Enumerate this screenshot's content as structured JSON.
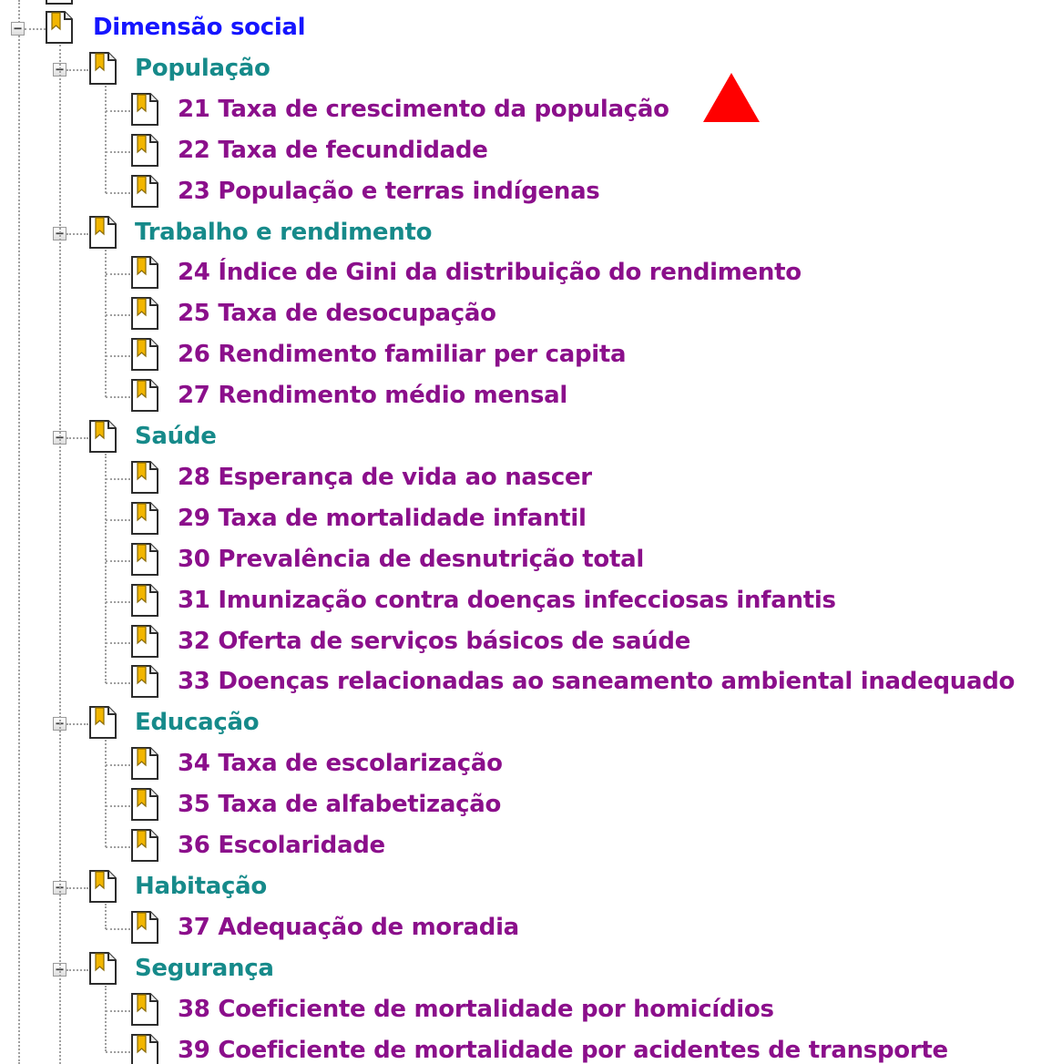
{
  "tree": {
    "root": {
      "label": "Dimensão social",
      "icon": "bookmark-icon",
      "expanded": true,
      "sections": [
        {
          "label": "População",
          "items": [
            "21 Taxa de crescimento da população",
            "22 Taxa de fecundidade",
            "23 População e terras indígenas"
          ]
        },
        {
          "label": "Trabalho e rendimento",
          "items": [
            "24 Índice de Gini da distribuição do rendimento",
            "25 Taxa de desocupação",
            "26 Rendimento familiar per capita",
            "27 Rendimento médio mensal"
          ]
        },
        {
          "label": "Saúde",
          "items": [
            "28 Esperança de vida ao nascer",
            "29 Taxa de mortalidade infantil",
            "30 Prevalência de desnutrição total",
            "31 Imunização contra doenças infecciosas infantis",
            "32 Oferta de serviços básicos de saúde",
            "33 Doenças relacionadas ao saneamento ambiental inadequado"
          ]
        },
        {
          "label": "Educação",
          "items": [
            "34 Taxa de escolarização",
            "35 Taxa de alfabetização",
            "36 Escolaridade"
          ]
        },
        {
          "label": "Habitação",
          "items": [
            "37 Adequação de moradia"
          ]
        },
        {
          "label": "Segurança",
          "items": [
            "38 Coeficiente de mortalidade por homicídios",
            "39 Coeficiente de mortalidade por acidentes de transporte"
          ]
        }
      ]
    }
  },
  "marker": {
    "shape": "triangle-up",
    "color": "#ff0000"
  },
  "colors": {
    "root": "#1515ff",
    "section": "#168a8a",
    "item": "#8b0f8b",
    "connector": "#a0a0a0"
  }
}
